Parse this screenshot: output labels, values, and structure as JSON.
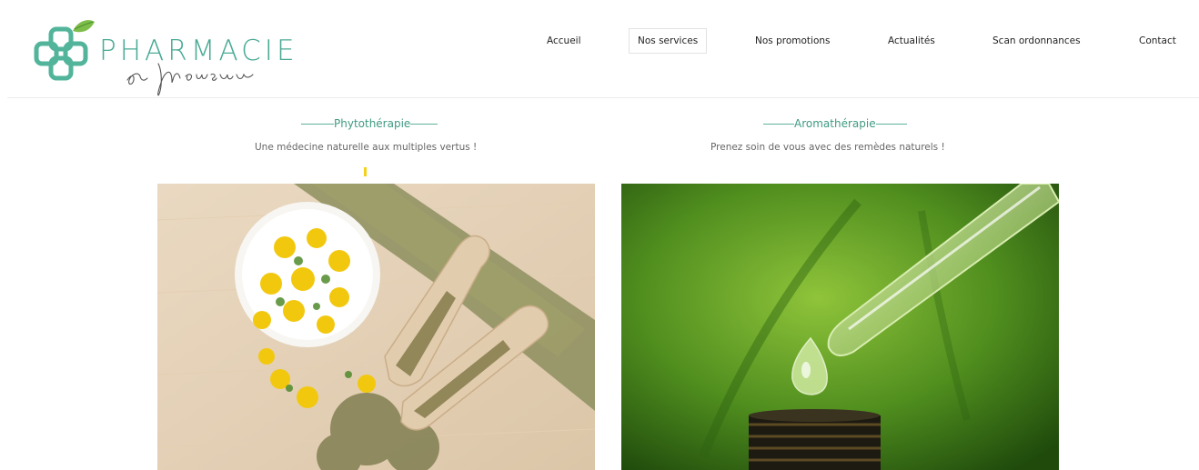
{
  "header": {
    "logo": {
      "name_main": "PHARMACIE",
      "name_script": "des Monceaux"
    },
    "nav": [
      {
        "label": "Accueil",
        "active": false
      },
      {
        "label": "Nos services",
        "active": true
      },
      {
        "label": "Nos promotions",
        "active": false
      },
      {
        "label": "Actualités",
        "active": false
      },
      {
        "label": "Scan ordonnances",
        "active": false
      },
      {
        "label": "Contact",
        "active": false
      }
    ]
  },
  "services": [
    {
      "title": "Phytothérapie",
      "subtitle": "Une médecine naturelle aux multiples vertus !",
      "image": "herbal-flowers-and-wooden-scoops"
    },
    {
      "title": "Aromathérapie",
      "subtitle": "Prenez soin de vous avec des remèdes naturels !",
      "image": "essential-oil-dropper"
    }
  ],
  "colors": {
    "brand_green": "#4aaa95",
    "accent_yellow": "#f2d21a"
  }
}
